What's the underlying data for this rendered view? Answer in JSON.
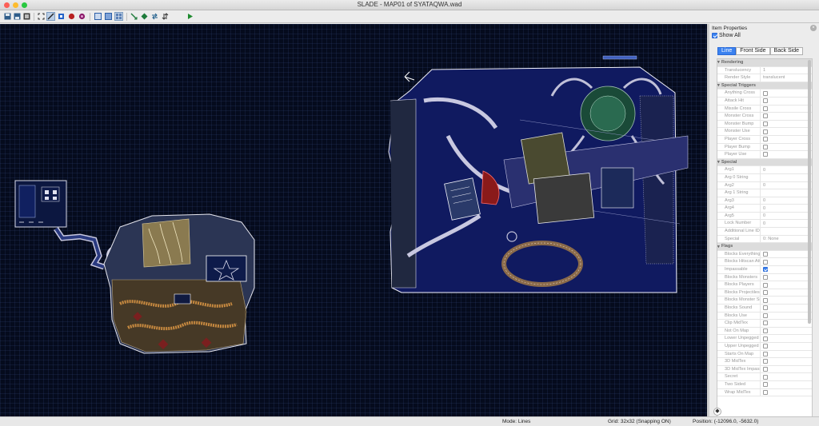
{
  "window": {
    "title": "SLADE - MAP01 of SYATAQWA.wad"
  },
  "toolbar": {
    "icons": [
      "save-icon",
      "save-all-icon",
      "close-map-icon",
      "fit-view-icon",
      "draw-lines-icon",
      "vertex-mode-icon",
      "sector-mode-icon",
      "things-mode-icon",
      "3d-mode-icon",
      "view-lines-icon",
      "view-sectors-icon",
      "view-things-icon",
      "edit-icon",
      "run-map-icon",
      "play-icon"
    ]
  },
  "panel": {
    "title": "Item Properties",
    "show_all": "Show All",
    "tabs": [
      {
        "label": "Line",
        "active": true
      },
      {
        "label": "Front Side",
        "active": false
      },
      {
        "label": "Back Side",
        "active": false
      }
    ],
    "rows": [
      {
        "type": "group",
        "label": "Rendering"
      },
      {
        "label": "Translucency",
        "value": "1"
      },
      {
        "label": "Render Style",
        "value": "translucent"
      },
      {
        "type": "group",
        "label": "Special Triggers"
      },
      {
        "label": "Anything Cross",
        "check": false
      },
      {
        "label": "Attack Hit",
        "check": false
      },
      {
        "label": "Missile Cross",
        "check": false
      },
      {
        "label": "Monster Cross",
        "check": false
      },
      {
        "label": "Monster Bump",
        "check": false
      },
      {
        "label": "Monster Use",
        "check": false
      },
      {
        "label": "Player Cross",
        "check": false
      },
      {
        "label": "Player Bump",
        "check": false
      },
      {
        "label": "Player Use",
        "check": false
      },
      {
        "type": "group",
        "label": "Special"
      },
      {
        "label": "Arg1",
        "value": "0"
      },
      {
        "label": "Arg 0 String",
        "value": ""
      },
      {
        "label": "Arg2",
        "value": "0"
      },
      {
        "label": "Arg 1 String",
        "value": ""
      },
      {
        "label": "Arg3",
        "value": "0"
      },
      {
        "label": "Arg4",
        "value": "0"
      },
      {
        "label": "Arg5",
        "value": "0"
      },
      {
        "label": "Lock Number",
        "value": "0"
      },
      {
        "label": "Additional Line IDs",
        "value": ""
      },
      {
        "label": "Special",
        "value": "0: None"
      },
      {
        "type": "group",
        "label": "Flags"
      },
      {
        "label": "Blocks Everything",
        "check": false
      },
      {
        "label": "Blocks Hitscan Attacks",
        "check": false
      },
      {
        "label": "Impassable",
        "check": true
      },
      {
        "label": "Blocks Monsters",
        "check": false
      },
      {
        "label": "Blocks Players",
        "check": false
      },
      {
        "label": "Blocks Projectiles",
        "check": false
      },
      {
        "label": "Blocks Monster Sight",
        "check": false
      },
      {
        "label": "Blocks Sound",
        "check": false
      },
      {
        "label": "Blocks Use",
        "check": false
      },
      {
        "label": "Clip MidTex",
        "check": false
      },
      {
        "label": "Not On Map",
        "check": false
      },
      {
        "label": "Lower Unpegged",
        "check": false
      },
      {
        "label": "Upper Unpegged",
        "check": false
      },
      {
        "label": "Starts On Map",
        "check": false
      },
      {
        "label": "3D MidTex",
        "check": false
      },
      {
        "label": "3D MidTex Impassable",
        "check": false
      },
      {
        "label": "Secret",
        "check": false
      },
      {
        "label": "Two Sided",
        "check": false
      },
      {
        "label": "Wrap MidTex",
        "check": false
      }
    ]
  },
  "status": {
    "mode": "Mode: Lines",
    "grid": "Grid: 32x32 (Snapping ON)",
    "position": "Position: (-12096.0, -5632.0)"
  },
  "colors": {
    "close": "#fc5f57",
    "minimize": "#fdbc2e",
    "zoom": "#28c840",
    "canvas_bg": "#050b1d",
    "accent": "#3b82f0"
  }
}
